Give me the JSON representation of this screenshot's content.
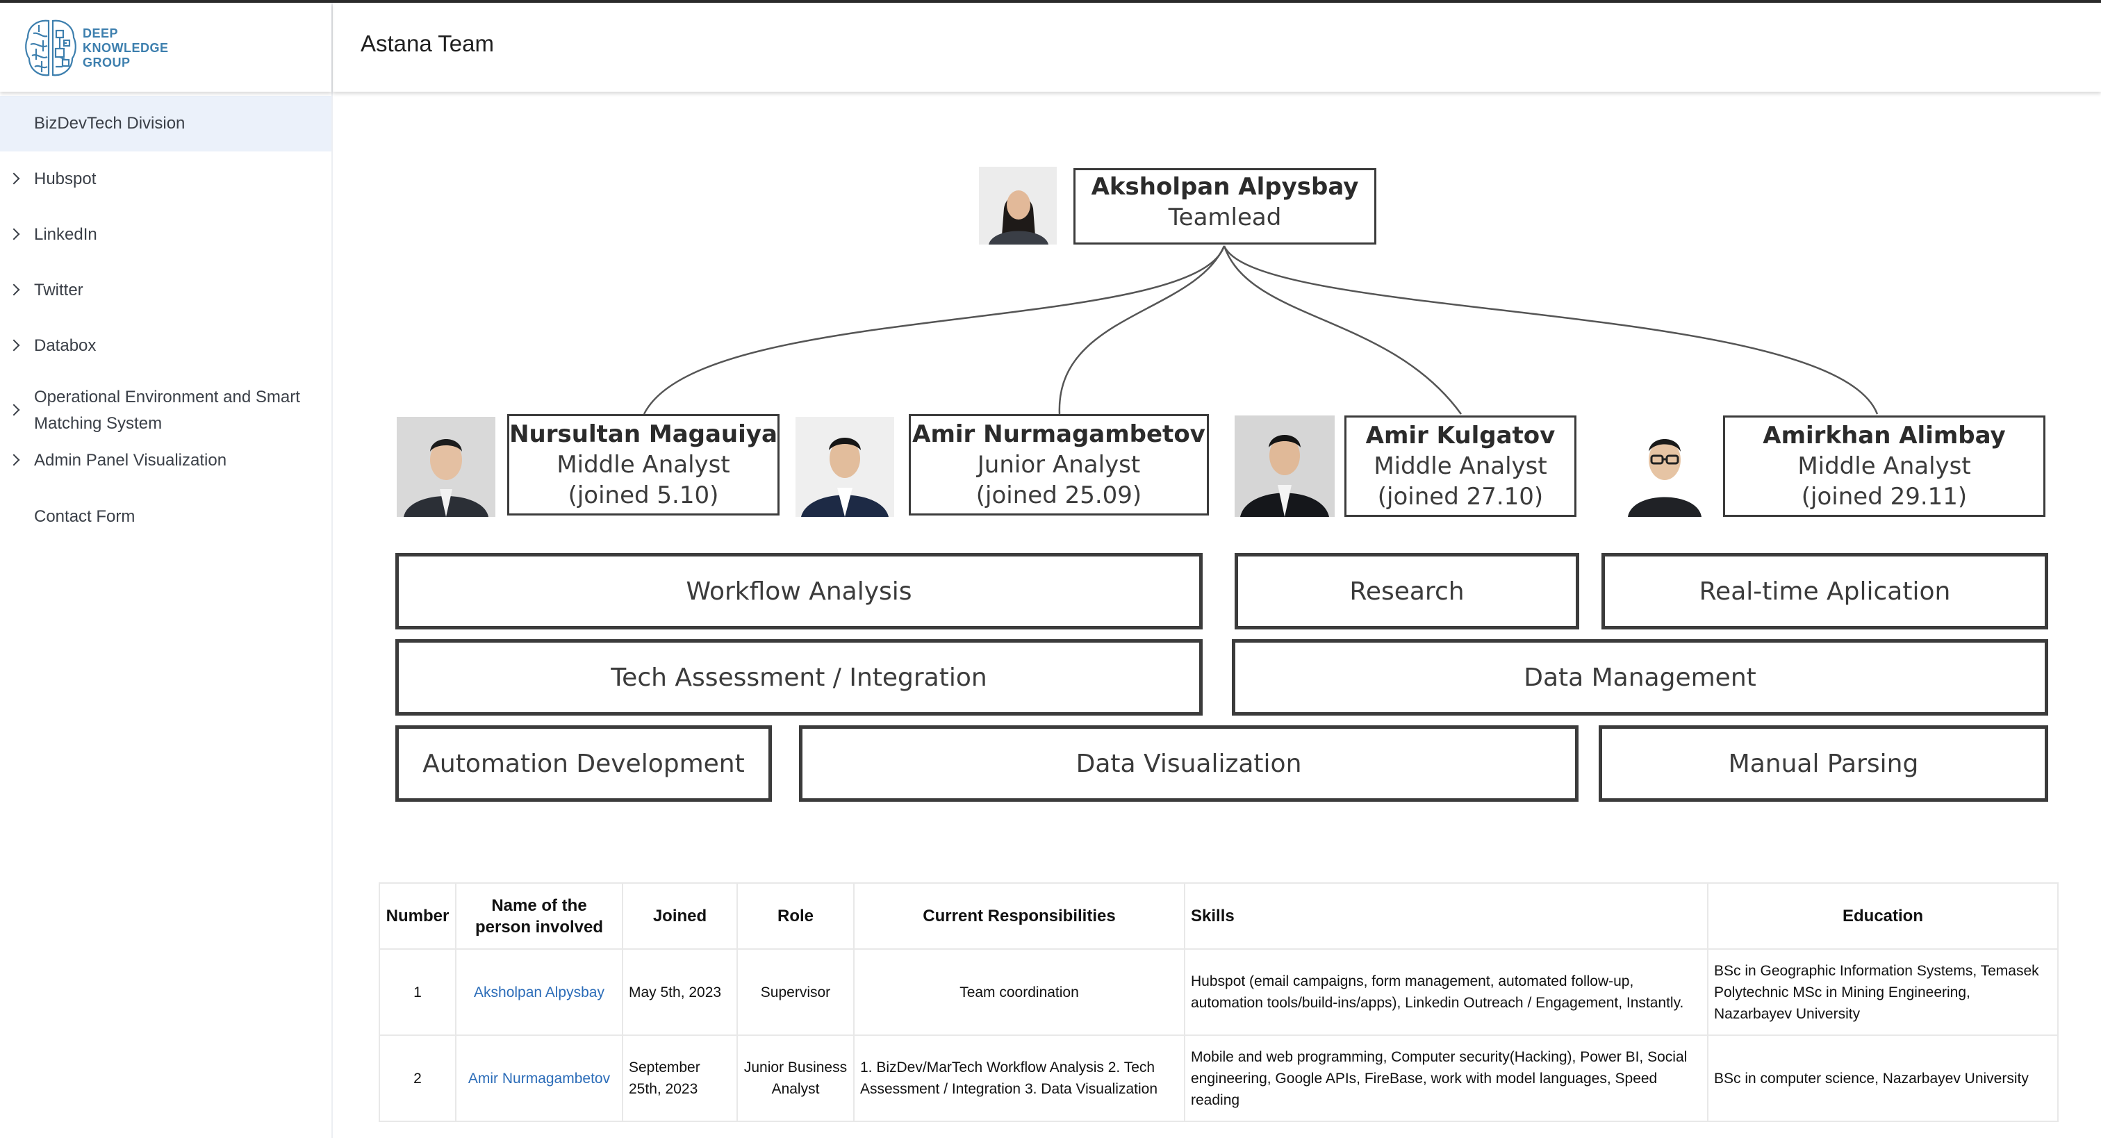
{
  "logo": {
    "icon": "brain-icon",
    "lines": [
      "DEEP",
      "KNOWLEDGE",
      "GROUP"
    ]
  },
  "header": {
    "title": "Astana Team"
  },
  "sidebar": {
    "items": [
      {
        "label": "BizDevTech Division",
        "expandable": false,
        "active": true
      },
      {
        "label": "Hubspot",
        "expandable": true
      },
      {
        "label": "LinkedIn",
        "expandable": true
      },
      {
        "label": "Twitter",
        "expandable": true
      },
      {
        "label": "Databox",
        "expandable": true
      },
      {
        "label": "Operational Environment and Smart Matching System",
        "line1": "Operational Environment and Smart",
        "line2": "Matching System",
        "expandable": true
      },
      {
        "label": "Admin Panel Visualization",
        "expandable": true
      },
      {
        "label": "Contact Form",
        "expandable": false
      }
    ]
  },
  "org": {
    "lead": {
      "name": "Aksholpan Alpysbay",
      "role": "Teamlead"
    },
    "members": [
      {
        "name": "Nursultan Magauiya",
        "role": "Middle Analyst",
        "joined": "(joined 5.10)"
      },
      {
        "name": "Amir Nurmagambetov",
        "role": "Junior  Analyst",
        "joined": "(joined 25.09)"
      },
      {
        "name": "Amir Kulgatov",
        "role": "Middle Analyst",
        "joined": "(joined 27.10)"
      },
      {
        "name": "Amirkhan Alimbay",
        "role": "Middle Analyst",
        "joined": "(joined 29.11)"
      }
    ],
    "areas": [
      "Workflow Analysis",
      "Research",
      "Real-time Aplication",
      "Tech Assessment / Integration",
      "Data Management",
      "Automation Development",
      "Data Visualization",
      "Manual Parsing"
    ]
  },
  "table": {
    "headers": [
      "Number",
      "Name of the person involved",
      "Joined",
      "Role",
      "Current Responsibilities",
      "Skills",
      "Education"
    ],
    "header_lines": {
      "name1": "Name of the",
      "name2": "person involved"
    },
    "rows": [
      {
        "number": "1",
        "name": "Aksholpan Alpysbay",
        "joined": "May 5th, 2023",
        "role": "Supervisor",
        "responsibilities": "Team coordination",
        "skills": "Hubspot (email campaigns, form management, automated follow-up, automation tools/build-ins/apps), Linkedin Outreach / Engagement, Instantly.",
        "education": "BSc in Geographic Information Systems, Temasek Polytechnic MSc in Mining Engineering, Nazarbayev University"
      },
      {
        "number": "2",
        "name": "Amir Nurmagambetov",
        "joined": "September 25th, 2023",
        "role": "Junior Business Analyst",
        "responsibilities": "1. BizDev/MarTech Workflow Analysis 2. Tech Assessment / Integration 3. Data Visualization",
        "skills": "Mobile and web programming, Computer security(Hacking), Power BI, Social engineering, Google APIs, FireBase, work with model languages, Speed reading",
        "education": "BSc in computer science, Nazarbayev University"
      }
    ]
  }
}
